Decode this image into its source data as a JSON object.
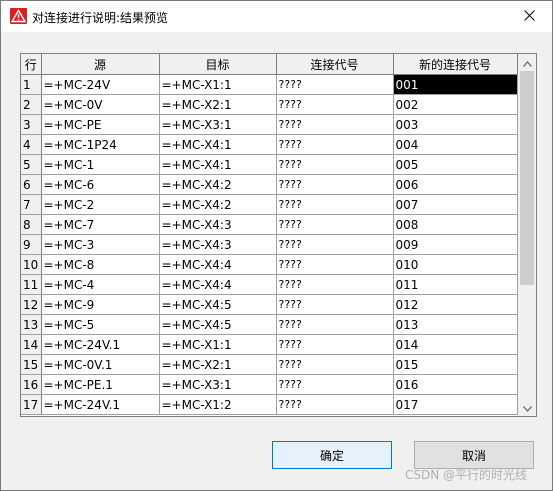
{
  "window": {
    "title": "对连接进行说明:结果预览",
    "icon": "warning-icon",
    "close_icon": "close-icon"
  },
  "table": {
    "headers": [
      "行",
      "源",
      "目标",
      "连接代号",
      "新的连接代号"
    ],
    "rows": [
      {
        "n": "1",
        "src": "=+MC-24V",
        "dst": "=+MC-X1:1",
        "code": "????",
        "newcode": "001"
      },
      {
        "n": "2",
        "src": "=+MC-0V",
        "dst": "=+MC-X2:1",
        "code": "????",
        "newcode": "002"
      },
      {
        "n": "3",
        "src": "=+MC-PE",
        "dst": "=+MC-X3:1",
        "code": "????",
        "newcode": "003"
      },
      {
        "n": "4",
        "src": "=+MC-1P24",
        "dst": "=+MC-X4:1",
        "code": "????",
        "newcode": "004"
      },
      {
        "n": "5",
        "src": "=+MC-1",
        "dst": "=+MC-X4:1",
        "code": "????",
        "newcode": "005"
      },
      {
        "n": "6",
        "src": "=+MC-6",
        "dst": "=+MC-X4:2",
        "code": "????",
        "newcode": "006"
      },
      {
        "n": "7",
        "src": "=+MC-2",
        "dst": "=+MC-X4:2",
        "code": "????",
        "newcode": "007"
      },
      {
        "n": "8",
        "src": "=+MC-7",
        "dst": "=+MC-X4:3",
        "code": "????",
        "newcode": "008"
      },
      {
        "n": "9",
        "src": "=+MC-3",
        "dst": "=+MC-X4:3",
        "code": "????",
        "newcode": "009"
      },
      {
        "n": "10",
        "src": "=+MC-8",
        "dst": "=+MC-X4:4",
        "code": "????",
        "newcode": "010"
      },
      {
        "n": "11",
        "src": "=+MC-4",
        "dst": "=+MC-X4:4",
        "code": "????",
        "newcode": "011"
      },
      {
        "n": "12",
        "src": "=+MC-9",
        "dst": "=+MC-X4:5",
        "code": "????",
        "newcode": "012"
      },
      {
        "n": "13",
        "src": "=+MC-5",
        "dst": "=+MC-X4:5",
        "code": "????",
        "newcode": "013"
      },
      {
        "n": "14",
        "src": "=+MC-24V.1",
        "dst": "=+MC-X1:1",
        "code": "????",
        "newcode": "014"
      },
      {
        "n": "15",
        "src": "=+MC-0V.1",
        "dst": "=+MC-X2:1",
        "code": "????",
        "newcode": "015"
      },
      {
        "n": "16",
        "src": "=+MC-PE.1",
        "dst": "=+MC-X3:1",
        "code": "????",
        "newcode": "016"
      },
      {
        "n": "17",
        "src": "=+MC-24V.1",
        "dst": "=+MC-X1:2",
        "code": "????",
        "newcode": "017"
      }
    ],
    "selected_row": "1"
  },
  "buttons": {
    "ok_label": "确定",
    "cancel_label": "取消"
  },
  "watermark": "CSDN @平行的时光线",
  "colors": {
    "selection": "#000000",
    "focus_border": "#0078d7",
    "warning": "#e81123"
  }
}
